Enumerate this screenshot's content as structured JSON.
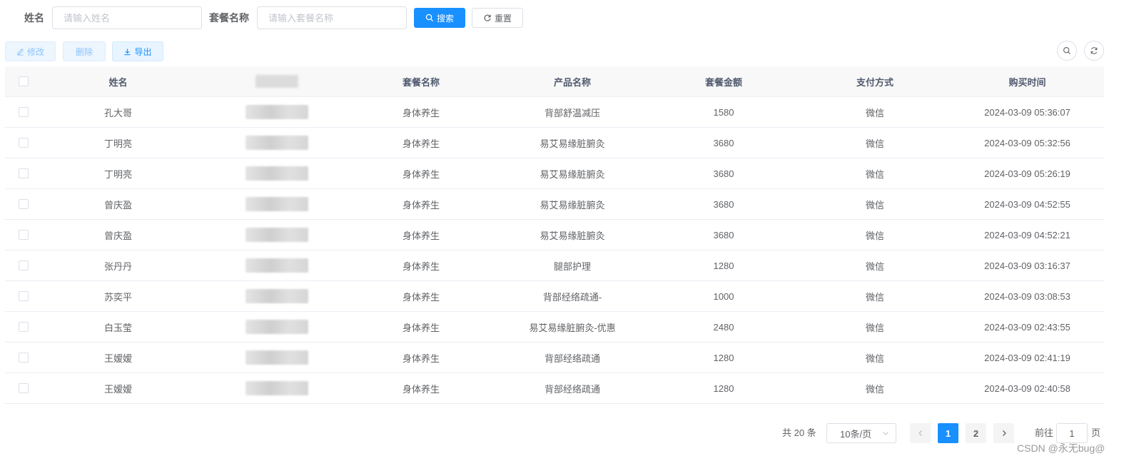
{
  "search": {
    "name_label": "姓名",
    "name_placeholder": "请输入姓名",
    "package_label": "套餐名称",
    "package_placeholder": "请输入套餐名称",
    "search_button": "搜索",
    "reset_button": "重置"
  },
  "toolbar": {
    "edit_label": "修改",
    "delete_label": "删除",
    "export_label": "导出"
  },
  "table": {
    "headers": [
      "姓名",
      "",
      "套餐名称",
      "产品名称",
      "套餐金额",
      "支付方式",
      "购买时间"
    ],
    "rows": [
      {
        "name": "孔大哥",
        "package": "身体养生",
        "product": "背部舒温减压",
        "amount": "1580",
        "payment": "微信",
        "time": "2024-03-09 05:36:07"
      },
      {
        "name": "丁明亮",
        "package": "身体养生",
        "product": "易艾易缘脏腑灸",
        "amount": "3680",
        "payment": "微信",
        "time": "2024-03-09 05:32:56"
      },
      {
        "name": "丁明亮",
        "package": "身体养生",
        "product": "易艾易缘脏腑灸",
        "amount": "3680",
        "payment": "微信",
        "time": "2024-03-09 05:26:19"
      },
      {
        "name": "曾庆盈",
        "package": "身体养生",
        "product": "易艾易缘脏腑灸",
        "amount": "3680",
        "payment": "微信",
        "time": "2024-03-09 04:52:55"
      },
      {
        "name": "曾庆盈",
        "package": "身体养生",
        "product": "易艾易缘脏腑灸",
        "amount": "3680",
        "payment": "微信",
        "time": "2024-03-09 04:52:21"
      },
      {
        "name": "张丹丹",
        "package": "身体养生",
        "product": "腿部护理",
        "amount": "1280",
        "payment": "微信",
        "time": "2024-03-09 03:16:37"
      },
      {
        "name": "苏奕平",
        "package": "身体养生",
        "product": "背部经络疏通-",
        "amount": "1000",
        "payment": "微信",
        "time": "2024-03-09 03:08:53"
      },
      {
        "name": "白玉莹",
        "package": "身体养生",
        "product": "易艾易缘脏腑灸-优惠",
        "amount": "2480",
        "payment": "微信",
        "time": "2024-03-09 02:43:55"
      },
      {
        "name": "王嫒嫒",
        "package": "身体养生",
        "product": "背部经络疏通",
        "amount": "1280",
        "payment": "微信",
        "time": "2024-03-09 02:41:19"
      },
      {
        "name": "王嫒嫒",
        "package": "身体养生",
        "product": "背部经络疏通",
        "amount": "1280",
        "payment": "微信",
        "time": "2024-03-09 02:40:58"
      }
    ]
  },
  "pagination": {
    "total_text": "共 20 条",
    "page_size": "10条/页",
    "pages": [
      "1",
      "2"
    ],
    "current_page": "1",
    "goto_label": "前往",
    "goto_value": "1",
    "page_suffix": "页"
  },
  "watermark": "CSDN @永无bug@",
  "colors": {
    "primary": "#1890ff",
    "header_bg": "#f8f8f9",
    "border": "#ebeef5"
  }
}
